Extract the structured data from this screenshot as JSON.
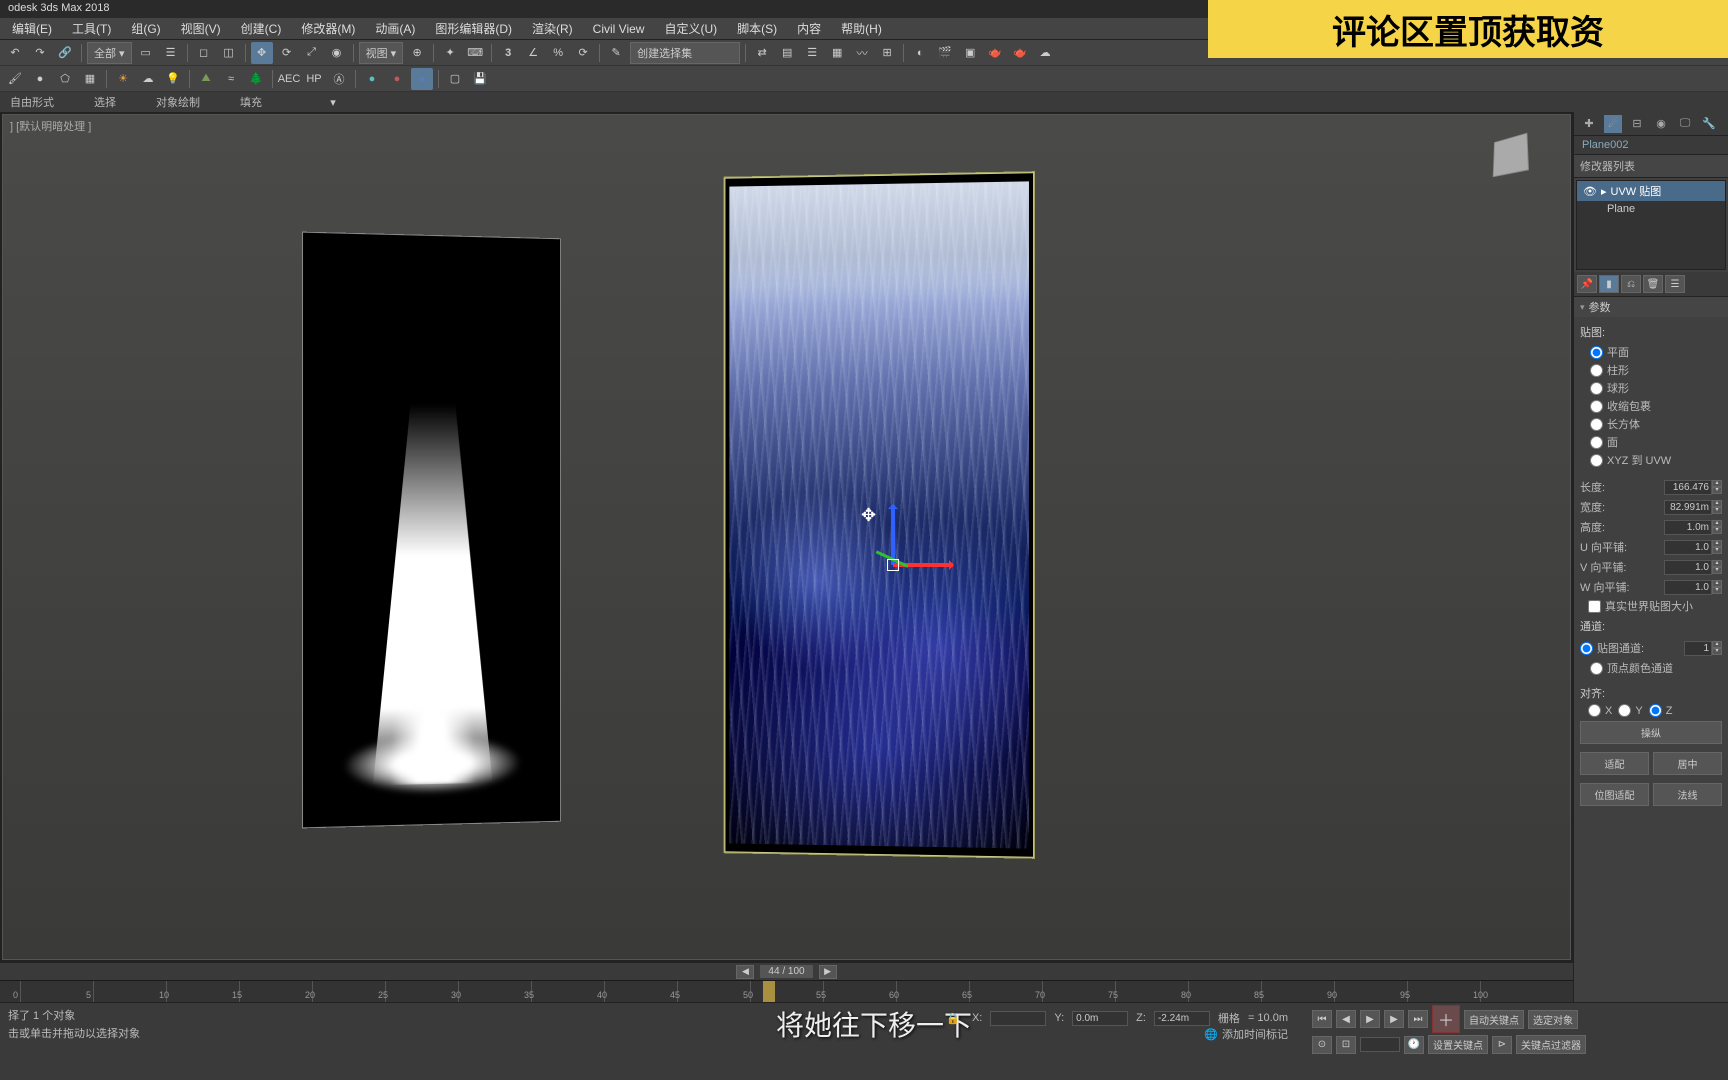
{
  "app": {
    "title": "odesk 3ds Max 2018"
  },
  "banner": "评论区置顶获取资",
  "menu": {
    "edit": "编辑(E)",
    "tools": "工具(T)",
    "group": "组(G)",
    "views": "视图(V)",
    "create": "创建(C)",
    "modifiers": "修改器(M)",
    "animation": "动画(A)",
    "graph": "图形编辑器(D)",
    "render": "渲染(R)",
    "civil": "Civil View",
    "customize": "自定义(U)",
    "script": "脚本(S)",
    "content": "内容",
    "help": "帮助(H)"
  },
  "toolbar": {
    "all": "全部",
    "view_dd": "视图",
    "create_sel": "创建选择集"
  },
  "subtoolbar": {
    "free": "自由形式",
    "select": "选择",
    "obj_paint": "对象绘制",
    "fill": "填充"
  },
  "viewport": {
    "label": "] [默认明暗处理 ]"
  },
  "timeline": {
    "frame_readout": "44 / 100",
    "ticks": [
      "0",
      "5",
      "10",
      "15",
      "20",
      "25",
      "30",
      "35",
      "40",
      "45",
      "50",
      "55",
      "60",
      "65",
      "70",
      "75",
      "80",
      "85",
      "90",
      "95",
      "100"
    ]
  },
  "status": {
    "line1": "择了 1 个对象",
    "line2": "击或单击并拖动以选择对象",
    "x_label": "X:",
    "x_val": "",
    "y_label": "Y:",
    "y_val": "0.0m",
    "z_label": "Z:",
    "z_val": "-2.24m",
    "grid_label": "栅格",
    "grid_val": "= 10.0m",
    "auto_key": "自动关键点",
    "sel_obj": "选定对象",
    "set_key": "设置关键点",
    "key_filter": "关键点过滤器",
    "add_marker": "添加时间标记"
  },
  "subtitle": "将她往下移一下",
  "panel": {
    "obj_name": "Plane002",
    "mod_list_label": "修改器列表",
    "mods": {
      "uvw": "UVW 贴图",
      "plane_base": "Plane"
    },
    "rollout_params": "参数",
    "group_mapping": "贴图:",
    "map_planar": "平面",
    "map_cyl": "柱形",
    "map_sphere": "球形",
    "map_shrink": "收缩包裹",
    "map_box": "长方体",
    "map_face": "面",
    "map_xyz": "XYZ 到 UVW",
    "len_label": "长度:",
    "len_val": "166.476",
    "wid_label": "宽度:",
    "wid_val": "82.991m",
    "hei_label": "高度:",
    "hei_val": "1.0m",
    "tile_u_label": "U 向平铺:",
    "tile_u": "1.0",
    "tile_v_label": "V 向平铺:",
    "tile_v": "1.0",
    "tile_w_label": "W 向平铺:",
    "tile_w": "1.0",
    "realworld": "真实世界贴图大小",
    "group_channel": "通道:",
    "map_ch": "贴图通道:",
    "map_ch_val": "1",
    "vcol_ch": "顶点颜色通道",
    "group_align": "对齐:",
    "ax": "X",
    "ay": "Y",
    "az": "Z",
    "btn_manip": "操纵",
    "btn_fit": "适配",
    "btn_center": "居中",
    "btn_bitmap": "位图适配",
    "btn_normal": "法线"
  }
}
